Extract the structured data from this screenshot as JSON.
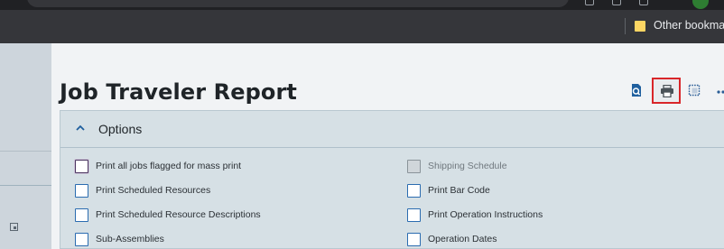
{
  "bookmarks": {
    "other_bookmarks": "Other bookmarks"
  },
  "page": {
    "title": "Job Traveler Report"
  },
  "toolbar": {
    "icons": [
      "preview-icon",
      "print-icon",
      "view-icon",
      "more-icon"
    ],
    "highlight_color": "#d9262a"
  },
  "options": {
    "title": "Options",
    "expanded": true,
    "left_column": [
      {
        "label": "Print all jobs flagged for mass print",
        "checked": false,
        "focused": true
      },
      {
        "label": "Print Scheduled Resources",
        "checked": false
      },
      {
        "label": "Print Scheduled Resource Descriptions",
        "checked": false
      },
      {
        "label": "Sub-Assemblies",
        "checked": false
      }
    ],
    "right_column": [
      {
        "label": "Shipping Schedule",
        "checked": false,
        "disabled": true
      },
      {
        "label": "Print Bar Code",
        "checked": false
      },
      {
        "label": "Print Operation Instructions",
        "checked": false
      },
      {
        "label": "Operation Dates",
        "checked": false
      }
    ]
  },
  "colors": {
    "accent": "#2b6cb0",
    "panel_bg": "#d6e0e5",
    "chrome_bg": "#35363a"
  }
}
